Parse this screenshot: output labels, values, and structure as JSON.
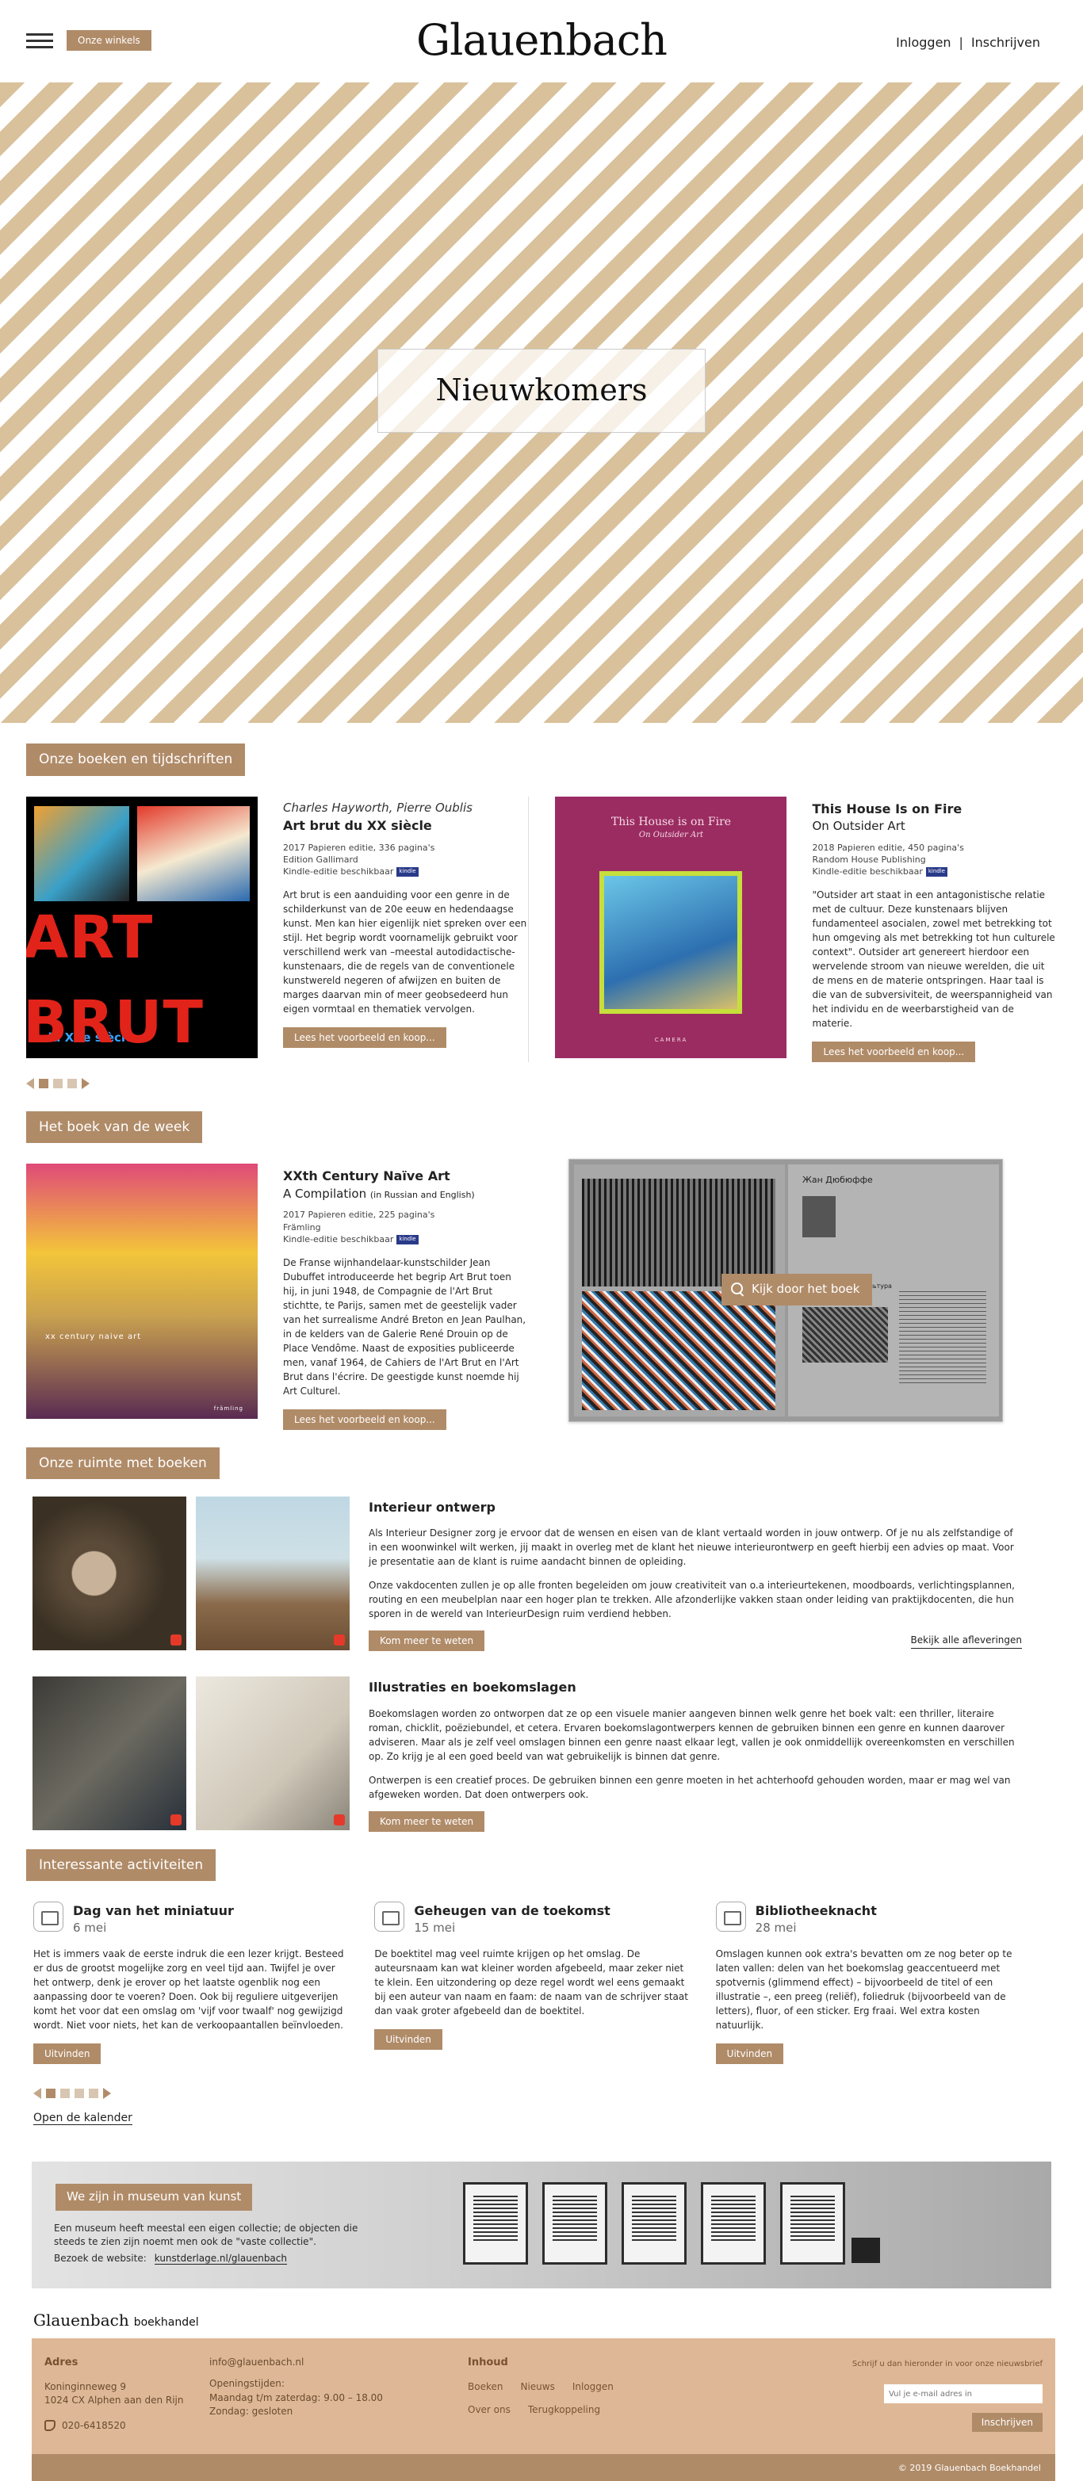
{
  "header": {
    "stores_label": "Onze winkels",
    "logo": "Glauenbach",
    "login": "Inloggen",
    "separator": "|",
    "signup": "Inschrijven"
  },
  "hero": {
    "title": "Nieuwkomers"
  },
  "books_section": {
    "tab": "Onze boeken en tijdschriften",
    "books": [
      {
        "author": "Charles Hayworth, Pierre Oublis",
        "title": "Art brut du XX siècle",
        "subtitle": "",
        "meta": [
          "2017 Papieren editie, 336 pagina's",
          "Edition Gallimard",
          "Kindle-editie beschikbaar"
        ],
        "description": "Art brut is een aanduiding voor een genre in de schilderkunst van de 20e eeuw en hedendaagse kunst. Men kan hier eigenlijk niet spreken over een stijl. Het begrip wordt voornamelijk gebruikt voor verschillend werk van –meestal autodidactische- kunstenaars, die de regels van de conventionele kunstwereld negeren of afwijzen en buiten de marges daarvan min of meer geobsedeerd hun eigen vormtaal en thematiek vervolgen.",
        "button": "Lees het voorbeeld en koop...",
        "cover_tag": "du XXe siècle",
        "cover_big": "ART BRUT"
      },
      {
        "author": "",
        "title": "This House Is on Fire",
        "subtitle": "On Outsider Art",
        "meta": [
          "2018 Papieren editie, 450 pagina's",
          "Random House Publishing",
          "Kindle-editie beschikbaar"
        ],
        "description": "\"Outsider art staat in een antagonistische relatie met de cultuur. Deze kunstenaars blijven fundamenteel asocialen, zowel met betrekking tot hun omgeving als met betrekking tot hun culturele context\". Outsider art genereert hierdoor een wervelende stroom van nieuwe werelden, die uit de mens en de materie ontspringen. Haar taal is die van de subversiviteit, de weerspannigheid van het individu en de weerbarstigheid van de materie.",
        "button": "Lees het voorbeeld en koop...",
        "cover_title": "This House is on Fire",
        "cover_sub": "On Outsider Art",
        "cover_pub": "CAMERA"
      }
    ],
    "kindle_badge": "kindle"
  },
  "week_section": {
    "tab": "Het boek van de week",
    "book": {
      "title": "XXth Century Naïve Art",
      "subtitle": "A Compilation",
      "subtitle_note": "(in Russian and English)",
      "meta": [
        "2017 Papieren editie, 225 pagina's",
        "Främling",
        "Kindle-editie beschikbaar"
      ],
      "description": "De Franse wijnhandelaar-kunstschilder Jean Dubuffet introduceerde het begrip Art Brut toen hij, in juni 1948, de Compagnie de l'Art Brut stichtte, te Parijs, samen met de geestelijk vader van het surrealisme André Breton en Jean Paulhan, in de kelders van de Galerie René Drouin op de Place Vendôme. Naast de exposities publiceerde men, vanaf 1964, de Cahiers de l'Art Brut en l'Art Brut dans l'écrire. De geestigde kunst noemde hij Art Culturel.",
      "button": "Lees het voorbeeld en koop...",
      "cover_text": "xx century naive art",
      "cover_pub": "främling"
    },
    "spread_title": "Жан Дюбюффе",
    "spread_sub": "Художественная культура",
    "browse": "Kijk door het boek"
  },
  "space_section": {
    "tab": "Onze ruimte met boeken",
    "items": [
      {
        "title": "Interieur ontwerp",
        "p1": "Als Interieur Designer zorg je ervoor dat de wensen en eisen van de klant vertaald worden in jouw ontwerp. Of je nu als zelfstandige of in een woonwinkel wilt werken, jij maakt in overleg met de klant het nieuwe interieurontwerp en geeft hierbij een advies op maat. Voor je presentatie aan de klant is ruime aandacht binnen de opleiding.",
        "p2": "Onze vakdocenten zullen je op alle fronten begeleiden om jouw creativiteit van o.a interieurtekenen, moodboards, verlichtingsplannen, routing en een meubelplan naar een hoger plan te trekken. Alle afzonderlijke vakken staan onder leiding van praktijkdocenten, die hun sporen in de wereld van InterieurDesign ruim verdiend hebben.",
        "button": "Kom meer te weten",
        "link": "Bekijk alle afleveringen"
      },
      {
        "title": "Illustraties en boekomslagen",
        "p1": "Boekomslagen worden zo ontworpen dat ze op een visuele manier aangeven binnen welk genre het boek valt: een thriller, literaire roman, chicklit, poëziebundel, et cetera. Ervaren boekomslagontwerpers kennen de gebruiken binnen een genre en kunnen daarover adviseren. Maar als je zelf veel omslagen binnen een genre naast elkaar legt, vallen je ook onmiddellijk overeenkomsten en verschillen op. Zo krijg je al een goed beeld van wat gebruikelijk is binnen dat genre.",
        "p2": "Ontwerpen is een creatief proces. De gebruiken binnen een genre moeten in het achterhoofd gehouden worden, maar er mag wel van afgeweken worden. Dat doen ontwerpers ook.",
        "button": "Kom meer te weten"
      }
    ]
  },
  "activities_section": {
    "tab": "Interessante activiteiten",
    "items": [
      {
        "title": "Dag van het miniatuur",
        "date": "6 mei",
        "text": "Het is immers vaak de eerste indruk die een lezer krijgt. Besteed er dus de grootst mogelijke zorg en veel tijd aan. Twijfel je over het ontwerp, denk je erover op het laatste ogenblik nog een aanpassing door te voeren? Doen. Ook bij reguliere uitgeverijen komt het voor dat een omslag om 'vijf voor twaalf' nog gewijzigd wordt. Niet voor niets, het kan de verkoopaantallen beïnvloeden.",
        "button": "Uitvinden"
      },
      {
        "title": "Geheugen van de toekomst",
        "date": "15 mei",
        "text": "De boektitel mag veel ruimte krijgen op het omslag. De auteursnaam kan wat kleiner worden afgebeeld, maar zeker niet te klein. Een uitzondering op deze regel wordt wel eens gemaakt bij een auteur van naam en faam: de naam van de schrijver staat dan vaak groter afgebeeld dan de boektitel.",
        "button": "Uitvinden"
      },
      {
        "title": "Bibliotheeknacht",
        "date": "28 mei",
        "text": "Omslagen kunnen ook extra's bevatten om ze nog beter op te laten vallen: delen van het boekomslag geaccentueerd met spotvernis (glimmend effect) – bijvoorbeeld de titel of een illustratie –, een preeg (reliëf), foliedruk (bijvoorbeeld van de letters), fluor, of een sticker. Erg fraai. Wel extra kosten natuurlijk.",
        "button": "Uitvinden"
      }
    ],
    "calendar_link": "Open de kalender"
  },
  "museum": {
    "button": "We zijn in museum van kunst",
    "text": "Een museum heeft meestal een eigen collectie; de objecten die steeds te zien zijn noemt men ook de \"vaste collectie\".",
    "website_label": "Bezoek de website:",
    "website": "kunstderlage.nl/glauenbach"
  },
  "footer": {
    "brand": "Glauenbach",
    "brand_suffix": "boekhandel",
    "address_head": "Adres",
    "address_1": "Koninginneweg 9",
    "address_2": "1024 CX Alphen aan den Rijn",
    "phone": "020-6418520",
    "email": "info@glauenbach.nl",
    "hours_head": "Openingstijden:",
    "hours_1": "Maandag t/m zaterdag: 9.00 – 18.00",
    "hours_2": "Zondag: gesloten",
    "nav_head": "Inhoud",
    "nav_row1": [
      "Boeken",
      "Nieuws",
      "Inloggen"
    ],
    "nav_row2": [
      "Over ons",
      "Terugkoppeling"
    ],
    "newsletter_label": "Schrijf u dan hieronder in voor onze nieuwsbrief",
    "newsletter_placeholder": "Vul je e-mail adres in",
    "newsletter_button": "Inschrijven",
    "copyright": "© 2019 Glauenbach Boekhandel"
  },
  "colors": {
    "accent": "#b08b68",
    "stripe": "#d9c19b",
    "footer_bg": "#deb896"
  }
}
